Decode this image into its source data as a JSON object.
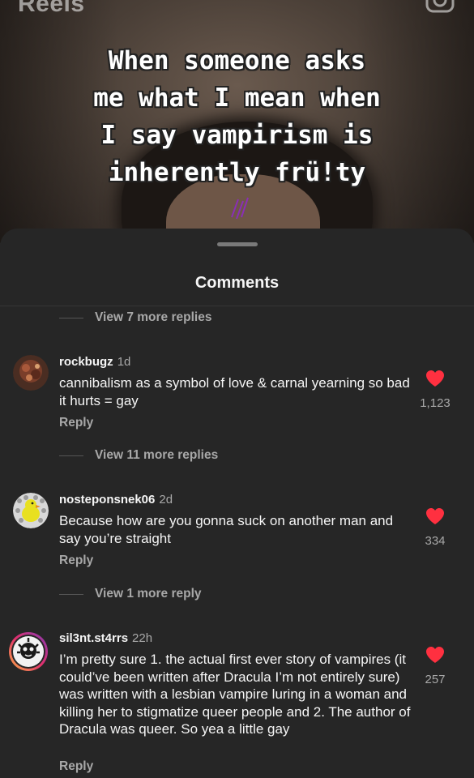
{
  "reel": {
    "header_title": "Reels",
    "caption": "When someone asks\nme what I mean when\nI say vampirism is\ninherently frü!ty",
    "camera_icon": "camera-icon"
  },
  "sheet": {
    "title": "Comments"
  },
  "threads": [
    {
      "view_replies": "View 7 more replies"
    },
    {
      "view_replies": "View 11 more replies"
    },
    {
      "view_replies": "View 1 more reply"
    }
  ],
  "comments": [
    {
      "username": "rockbugz",
      "time": "1d",
      "text": "cannibalism as a symbol of love & carnal yearning so bad it hurts = gay",
      "likes": "1,123",
      "reply_label": "Reply"
    },
    {
      "username": "nosteponsnek06",
      "time": "2d",
      "text": "Because how are you gonna suck on another man and say you’re straight",
      "likes": "334",
      "reply_label": "Reply"
    },
    {
      "username": "sil3nt.st4rrs",
      "time": "22h",
      "text": "I’m pretty sure 1. the actual first ever story of vampires (it could’ve been written after Dracula I’m not entirely sure) was written with a lesbian vampire luring in a woman and killing her to stigmatize queer people and 2. The author of Dracula was queer. So yea a little gay",
      "likes": "257",
      "reply_label": "Reply"
    }
  ],
  "colors": {
    "sheet_bg": "#262626",
    "like_red": "#ff3040",
    "muted_text": "#a8a8a8"
  }
}
